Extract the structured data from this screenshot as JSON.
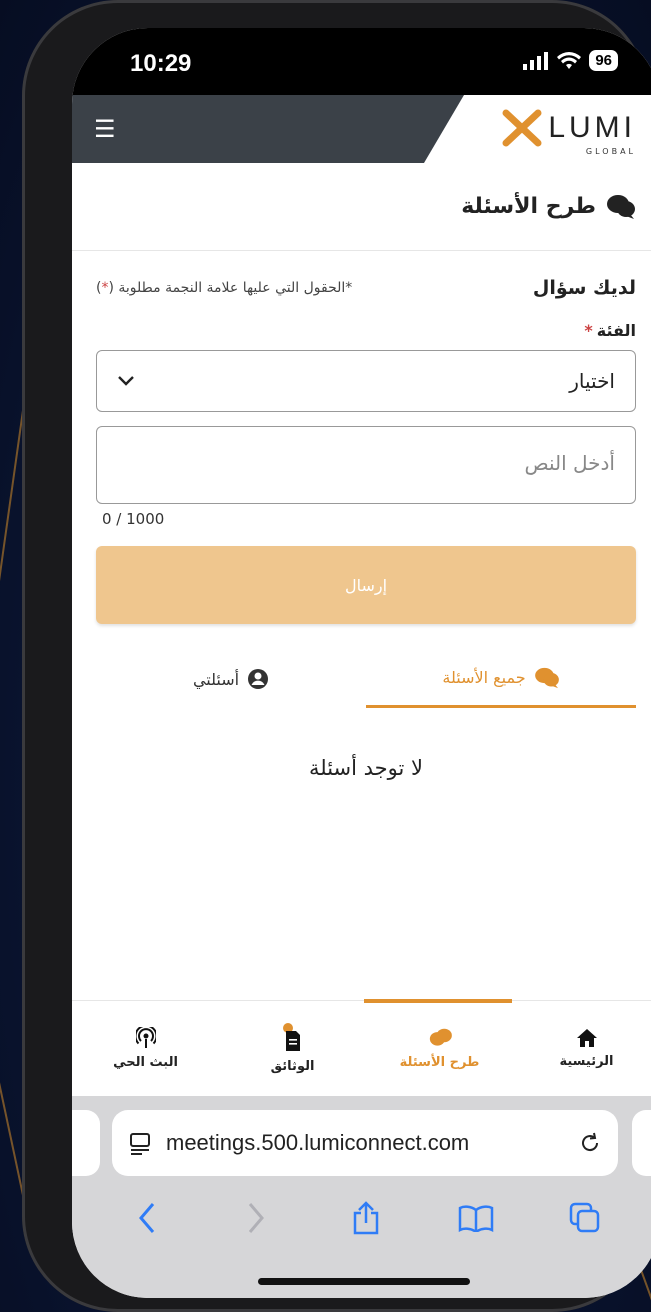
{
  "status_bar": {
    "time": "10:29",
    "battery": "96"
  },
  "header": {
    "logo_text": "LUMI",
    "logo_sub": "GLOBAL"
  },
  "page": {
    "title": "طرح الأسئلة"
  },
  "form": {
    "heading": "لديك سؤال",
    "required_note_prefix": "*الحقول التي عليها علامة النجمة مطلوبة (",
    "required_note_star": "*",
    "required_note_suffix": ")",
    "category_label": "الفئة",
    "category_star": "*",
    "select_value": "اختيار",
    "text_placeholder": "أدخل النص",
    "counter": "0 / 1000",
    "send_label": "إرسال"
  },
  "tabs": [
    {
      "label": "جميع الأسئلة",
      "active": true
    },
    {
      "label": "أسئلتي",
      "active": false
    }
  ],
  "empty_message": "لا توجد أسئلة",
  "bottom_nav": [
    {
      "label": "الرئيسية",
      "icon": "home-icon"
    },
    {
      "label": "طرح الأسئلة",
      "icon": "chat-icon",
      "active": true
    },
    {
      "label": "الوثائق",
      "icon": "document-icon"
    },
    {
      "label": "البث الحي",
      "icon": "broadcast-icon"
    }
  ],
  "browser": {
    "url": "meetings.500.lumiconnect.com"
  },
  "colors": {
    "accent": "#e0912f",
    "header_dark": "#3b4148",
    "send_disabled": "#efc68e",
    "ios_blue": "#2f7cf6"
  }
}
